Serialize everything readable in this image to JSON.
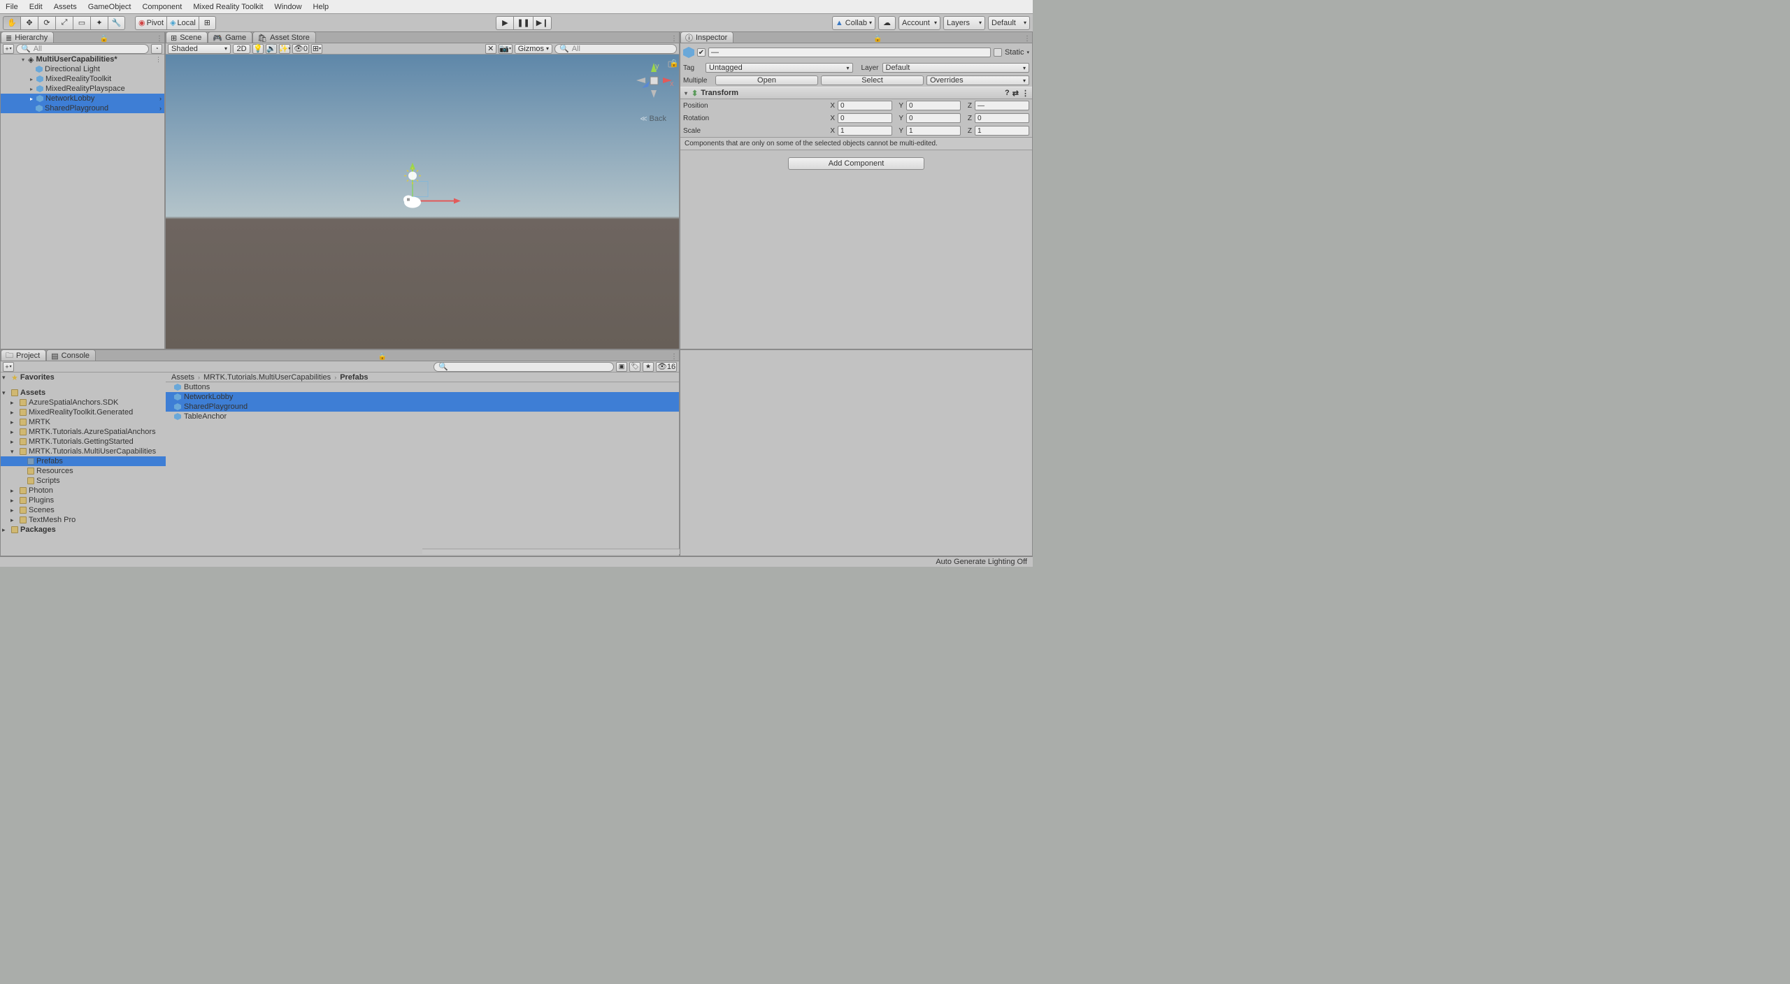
{
  "menu": [
    "File",
    "Edit",
    "Assets",
    "GameObject",
    "Component",
    "Mixed Reality Toolkit",
    "Window",
    "Help"
  ],
  "toolbar": {
    "pivot": "Pivot",
    "local": "Local",
    "collab": "Collab",
    "account": "Account",
    "layers": "Layers",
    "layout": "Default"
  },
  "hierarchy": {
    "title": "Hierarchy",
    "search_placeholder": "All",
    "scene": "MultiUserCapabilities*",
    "items": [
      "Directional Light",
      "MixedRealityToolkit",
      "MixedRealityPlayspace",
      "NetworkLobby",
      "SharedPlayground"
    ]
  },
  "sceneTabs": {
    "scene": "Scene",
    "game": "Game",
    "store": "Asset Store",
    "shaded": "Shaded",
    "mode2d": "2D",
    "gizmos": "Gizmos",
    "search": "All",
    "hidden": "0",
    "back": "Back"
  },
  "inspector": {
    "title": "Inspector",
    "dash": "—",
    "static": "Static",
    "tag_label": "Tag",
    "tag": "Untagged",
    "layer_label": "Layer",
    "layer": "Default",
    "multi_label": "Multiple",
    "open": "Open",
    "select": "Select",
    "overrides": "Overrides",
    "transform": "Transform",
    "position": "Position",
    "rotation": "Rotation",
    "scale": "Scale",
    "pos": {
      "x": "0",
      "y": "0",
      "z": "—"
    },
    "rot": {
      "x": "0",
      "y": "0",
      "z": "0"
    },
    "scl": {
      "x": "1",
      "y": "1",
      "z": "1"
    },
    "warn": "Components that are only on some of the selected objects cannot be multi-edited.",
    "add": "Add Component"
  },
  "project": {
    "projectTab": "Project",
    "consoleTab": "Console",
    "favorites": "Favorites",
    "assets": "Assets",
    "packages": "Packages",
    "tree": [
      "AzureSpatialAnchors.SDK",
      "MixedRealityToolkit.Generated",
      "MRTK",
      "MRTK.Tutorials.AzureSpatialAnchors",
      "MRTK.Tutorials.GettingStarted",
      "MRTK.Tutorials.MultiUserCapabilities"
    ],
    "sub": [
      "Prefabs",
      "Resources",
      "Scripts"
    ],
    "tree2": [
      "Photon",
      "Plugins",
      "Scenes",
      "TextMesh Pro"
    ],
    "crumbs": [
      "Assets",
      "MRTK.Tutorials.MultiUserCapabilities",
      "Prefabs"
    ],
    "items": [
      "Buttons",
      "NetworkLobby",
      "SharedPlayground",
      "TableAnchor"
    ],
    "count": "16",
    "search_placeholder": ""
  },
  "status": "Auto Generate Lighting Off"
}
